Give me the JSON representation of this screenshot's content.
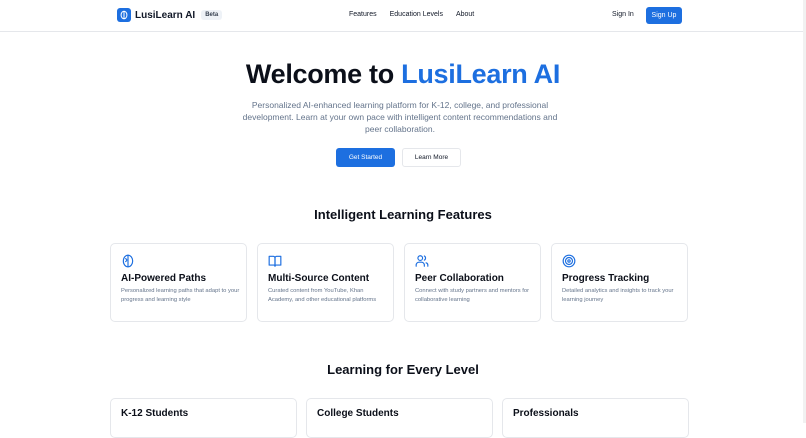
{
  "nav": {
    "brand": "LusiLearn AI",
    "badge": "Beta",
    "links": [
      "Features",
      "Education Levels",
      "About"
    ],
    "sign_in": "Sign In",
    "sign_up": "Sign Up"
  },
  "hero": {
    "title_prefix": "Welcome to ",
    "title_accent": "LusiLearn AI",
    "description": "Personalized AI-enhanced learning platform for K-12, college, and professional development. Learn at your own pace with intelligent content recommendations and peer collaboration.",
    "primary_button": "Get Started",
    "secondary_button": "Learn More"
  },
  "features": {
    "heading": "Intelligent Learning Features",
    "cards": [
      {
        "icon": "brain-icon",
        "title": "AI-Powered Paths",
        "description": "Personalized learning paths that adapt to your progress and learning style"
      },
      {
        "icon": "book-icon",
        "title": "Multi-Source Content",
        "description": "Curated content from YouTube, Khan Academy, and other educational platforms"
      },
      {
        "icon": "users-icon",
        "title": "Peer Collaboration",
        "description": "Connect with study partners and mentors for collaborative learning"
      },
      {
        "icon": "target-icon",
        "title": "Progress Tracking",
        "description": "Detailed analytics and insights to track your learning journey"
      }
    ]
  },
  "levels": {
    "heading": "Learning for Every Level",
    "cards": [
      {
        "title": "K-12 Students"
      },
      {
        "title": "College Students"
      },
      {
        "title": "Professionals"
      }
    ]
  },
  "colors": {
    "accent": "#1d6fe0",
    "muted_text": "#64748b",
    "border": "#e5e7eb"
  }
}
